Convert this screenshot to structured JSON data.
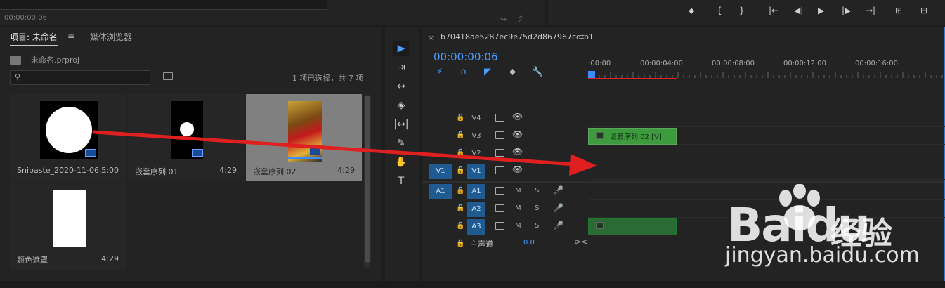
{
  "monitor": {
    "timecode": "00:00:00:06",
    "icons": [
      "↪",
      "⤴"
    ]
  },
  "transport": {
    "buttons": [
      "⬥",
      "{",
      "}",
      "|←",
      "◀|",
      "▶",
      "|▶",
      "→|",
      "⊞",
      "⊟"
    ]
  },
  "project": {
    "tab_label": "项目: 未命名",
    "tab_menu": "≡",
    "media_tab": "媒体浏览器",
    "file_name": "未命名.prproj",
    "search_icon": "⚲",
    "selection_status": "1 项已选择，共 7 项",
    "items": [
      {
        "name": "Snipaste_2020-11-06...",
        "duration": "5:00"
      },
      {
        "name": "嵌套序列 01",
        "duration": "4:29"
      },
      {
        "name": "嵌套序列 02",
        "duration": "4:29"
      },
      {
        "name": "颜色遮罩",
        "duration": "4:29"
      }
    ]
  },
  "tools": [
    "▶",
    "⇥",
    "↔",
    "◈",
    "|↔|",
    "✎",
    "✋",
    "T"
  ],
  "timeline": {
    "sequence_name": "b70418ae5287ec9e75d2d867967cdfb1",
    "close": "×",
    "menu": "≡",
    "timecode": "00:00:00:06",
    "ruler_labels": [
      ":00:00",
      "00:00:04:00",
      "00:00:08:00",
      "00:00:12:00",
      "00:00:16:00"
    ],
    "buttons": [
      "⚡",
      "∩",
      "◤",
      "⬥",
      "🔧"
    ],
    "tracks": {
      "video": [
        {
          "name": "V4",
          "lock": "🔒",
          "eye": "👁"
        },
        {
          "name": "V3",
          "lock": "🔒",
          "eye": "👁"
        },
        {
          "name": "V2",
          "lock": "🔒",
          "eye": "👁"
        },
        {
          "name": "V1",
          "lock": "🔒",
          "eye": "👁",
          "source": "V1"
        }
      ],
      "audio": [
        {
          "name": "A1",
          "source": "A1",
          "m": "M",
          "s": "S",
          "mic": "🎤"
        },
        {
          "name": "A2",
          "m": "M",
          "s": "S",
          "mic": "🎤"
        },
        {
          "name": "A3",
          "m": "M",
          "s": "S",
          "mic": "🎤"
        }
      ]
    },
    "clip_v3_label": "嵌套序列 02 [V]",
    "master_label": "主声道",
    "master_value": "0.0",
    "master_end": "⊳⊲"
  },
  "watermark": {
    "brand": "Bai",
    "brand2": "du",
    "cn": "经验",
    "url": "jingyan.baidu.com"
  },
  "colors": {
    "accent_blue": "#4a9eff",
    "clip_green": "#3d9a3d",
    "arrow_red": "#e02020"
  }
}
